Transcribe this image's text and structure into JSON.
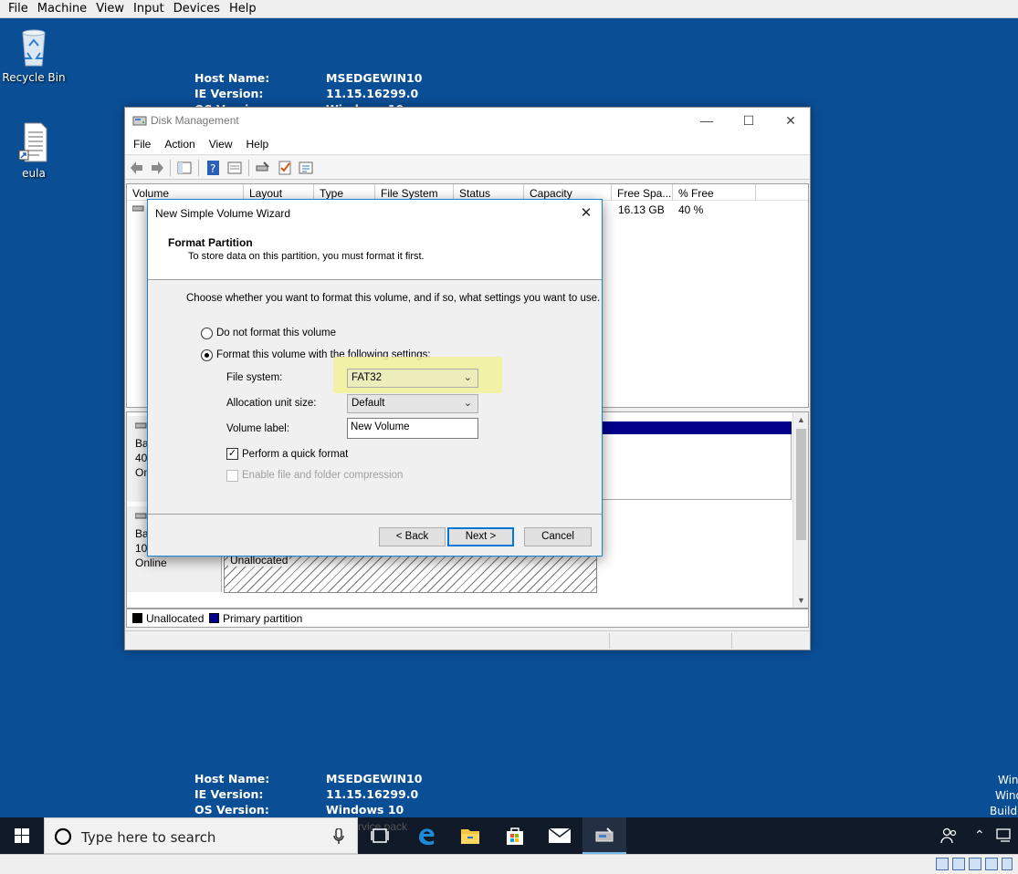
{
  "vbox_menubar": {
    "items": [
      "File",
      "Machine",
      "View",
      "Input",
      "Devices",
      "Help"
    ]
  },
  "desktop": {
    "icons": [
      {
        "label": "Recycle Bin",
        "icon": "recycle-bin-icon"
      },
      {
        "label": "eula",
        "icon": "text-document-shortcut-icon"
      }
    ],
    "bginfo_top": [
      {
        "key": "Host Name:",
        "value": "MSEDGEWIN10"
      },
      {
        "key": "IE Version:",
        "value": "11.15.16299.0"
      },
      {
        "key": "OS Versi",
        "value": "Windows 10"
      }
    ],
    "bginfo_bottom": [
      {
        "key": "Host Name:",
        "value": "MSEDGEWIN10"
      },
      {
        "key": "IE Version:",
        "value": "11.15.16299.0"
      },
      {
        "key": "OS Version:",
        "value": "Windows 10"
      }
    ],
    "bginfo_partial": "rvice pack",
    "corner_text": [
      "Win",
      "Wind",
      "Build"
    ]
  },
  "disk_management": {
    "title": "Disk Management",
    "menu": [
      "File",
      "Action",
      "View",
      "Help"
    ],
    "columns": [
      "Volume",
      "Layout",
      "Type",
      "File System",
      "Status",
      "Capacity",
      "Free Spa...",
      "% Free"
    ],
    "row": {
      "free_space": "16.13 GB",
      "percent_free": "40 %"
    },
    "disk0": {
      "line1": "Ba",
      "line2": "40.",
      "line3": "On"
    },
    "disk1": {
      "line1": "Ba",
      "line2": "10",
      "line3": "Online",
      "partition_label": "Unallocated"
    },
    "legend": [
      {
        "label": "Unallocated",
        "color": "#000000"
      },
      {
        "label": "Primary partition",
        "color": "#00008b"
      }
    ]
  },
  "wizard": {
    "title": "New Simple Volume Wizard",
    "header_title": "Format Partition",
    "header_subtitle": "To store data on this partition, you must format it first.",
    "instruction": "Choose whether you want to format this volume, and if so, what settings you want to use.",
    "option_no_format": "Do not format this volume",
    "option_format": "Format this volume with the following settings:",
    "selected_option": "format",
    "file_system_label": "File system:",
    "file_system_value": "FAT32",
    "alloc_label": "Allocation unit size:",
    "alloc_value": "Default",
    "volume_label_label": "Volume label:",
    "volume_label_value": "New Volume",
    "quick_format_label": "Perform a quick format",
    "quick_format_checked": true,
    "compression_label": "Enable file and folder compression",
    "compression_checked": false,
    "compression_enabled": false,
    "back_label": "< Back",
    "next_label": "Next >",
    "cancel_label": "Cancel",
    "highlight_color": "#f2f29a"
  },
  "taskbar": {
    "search_placeholder": "Type here to search",
    "apps": [
      "task-view-icon",
      "edge-icon",
      "file-explorer-icon",
      "store-icon",
      "mail-icon",
      "disk-management-icon"
    ]
  }
}
